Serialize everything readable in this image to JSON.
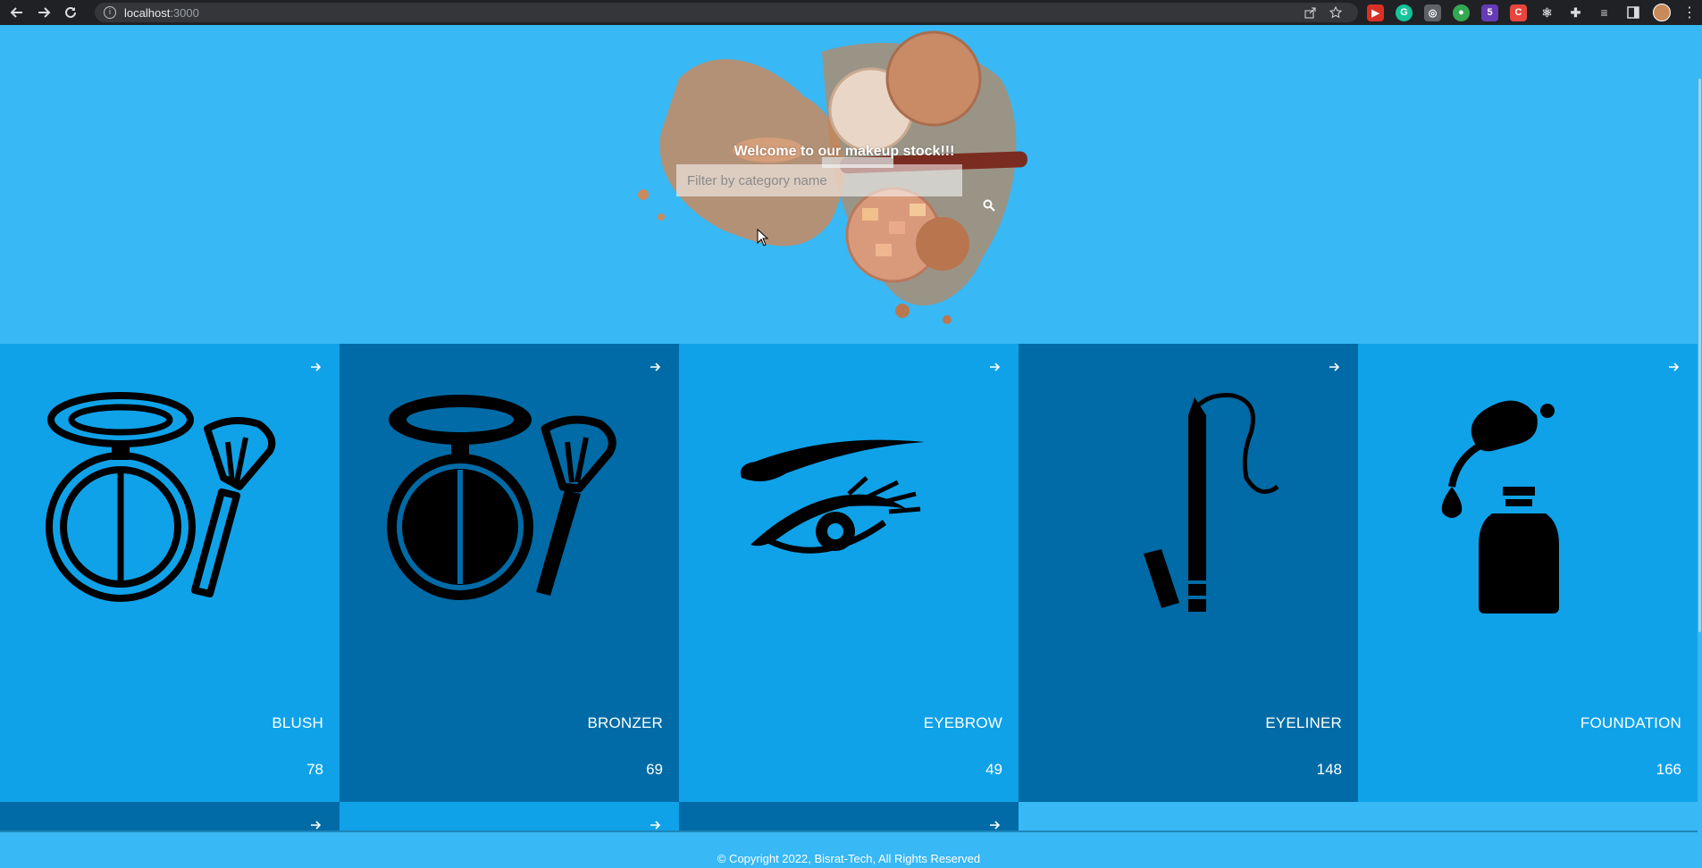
{
  "browser": {
    "url_host": "localhost",
    "url_port": ":3000",
    "info_glyph": "i"
  },
  "hero": {
    "title": "Welcome to our makeup stock!!!",
    "search_placeholder": "Filter by category name"
  },
  "categories": [
    {
      "name": "BLUSH",
      "count": "78",
      "icon": "blush-compact-icon",
      "shade": "light"
    },
    {
      "name": "BRONZER",
      "count": "69",
      "icon": "bronzer-compact-icon",
      "shade": "dark"
    },
    {
      "name": "EYEBROW",
      "count": "49",
      "icon": "eyebrow-icon",
      "shade": "light"
    },
    {
      "name": "EYELINER",
      "count": "148",
      "icon": "eyeliner-pencil-icon",
      "shade": "dark"
    },
    {
      "name": "FOUNDATION",
      "count": "166",
      "icon": "foundation-bottle-icon",
      "shade": "light"
    }
  ],
  "footer": {
    "copyright": "© Copyright 2022, Bisrat-Tech, All Rights Reserved"
  },
  "colors": {
    "background": "#38b8f4",
    "card_light": "#0fa2e9",
    "card_dark": "#006ba6"
  }
}
